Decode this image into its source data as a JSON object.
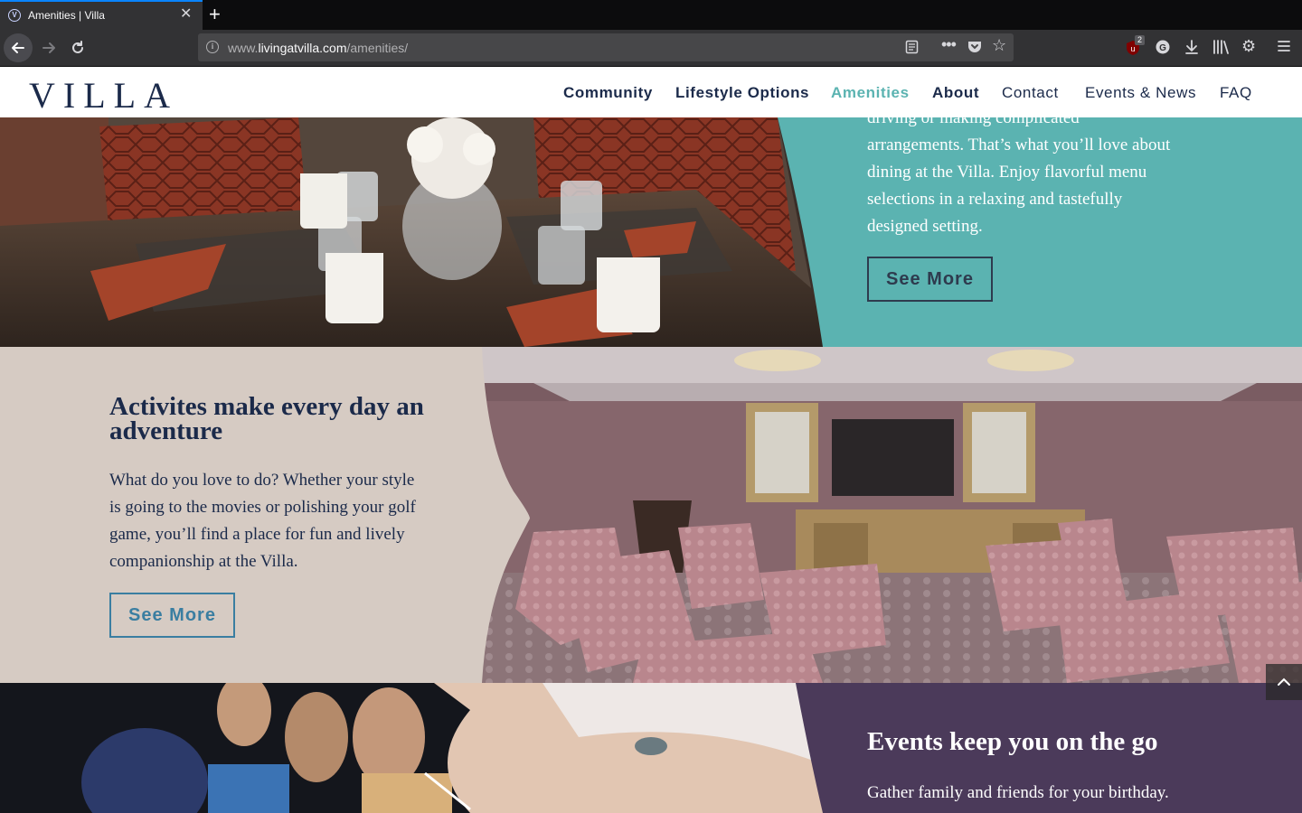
{
  "browser": {
    "tab_title": "Amenities | Villa",
    "url_prefix": "www.",
    "url_domain": "livingatvilla.com",
    "url_path": "/amenities/",
    "ublock_badge": "2",
    "icons": [
      "back-arrow-icon",
      "forward-arrow-icon",
      "reload-icon",
      "info-icon",
      "reader-view-icon",
      "more-actions-icon",
      "pocket-icon",
      "bookmark-star-icon",
      "ublock-icon",
      "grammarly-icon",
      "download-icon",
      "library-icon",
      "settings-icon",
      "hamburger-menu-icon"
    ]
  },
  "site": {
    "logo": "VILLA",
    "nav": [
      {
        "label": "Community"
      },
      {
        "label": "Lifestyle Options"
      },
      {
        "label": "Amenities"
      },
      {
        "label": "About"
      },
      {
        "label": "Contact"
      },
      {
        "label": "Events & News"
      },
      {
        "label": "FAQ"
      }
    ],
    "colors": {
      "navy": "#1b2a4a",
      "teal": "#5bb3b1",
      "beige": "#d6cbc3",
      "plum": "#4b3a5a"
    }
  },
  "dining": {
    "text_lines": [
      "driving or making complicated",
      "arrangements. That’s what you’ll love about",
      "dining at the Villa. Enjoy flavorful menu",
      "selections in a relaxing and tastefully",
      "designed setting."
    ],
    "button": "See More"
  },
  "activities": {
    "heading_line1": "Activites make every day an",
    "heading_line2": "adventure",
    "text_lines": [
      "What do you love to do? Whether your style",
      "is going to the movies or polishing your golf",
      "game, you’ll find a place for fun and lively",
      "companionship at the Villa."
    ],
    "button": "See More"
  },
  "events": {
    "heading": "Events keep you on the go",
    "text_line": "Gather family and friends for your birthday."
  }
}
